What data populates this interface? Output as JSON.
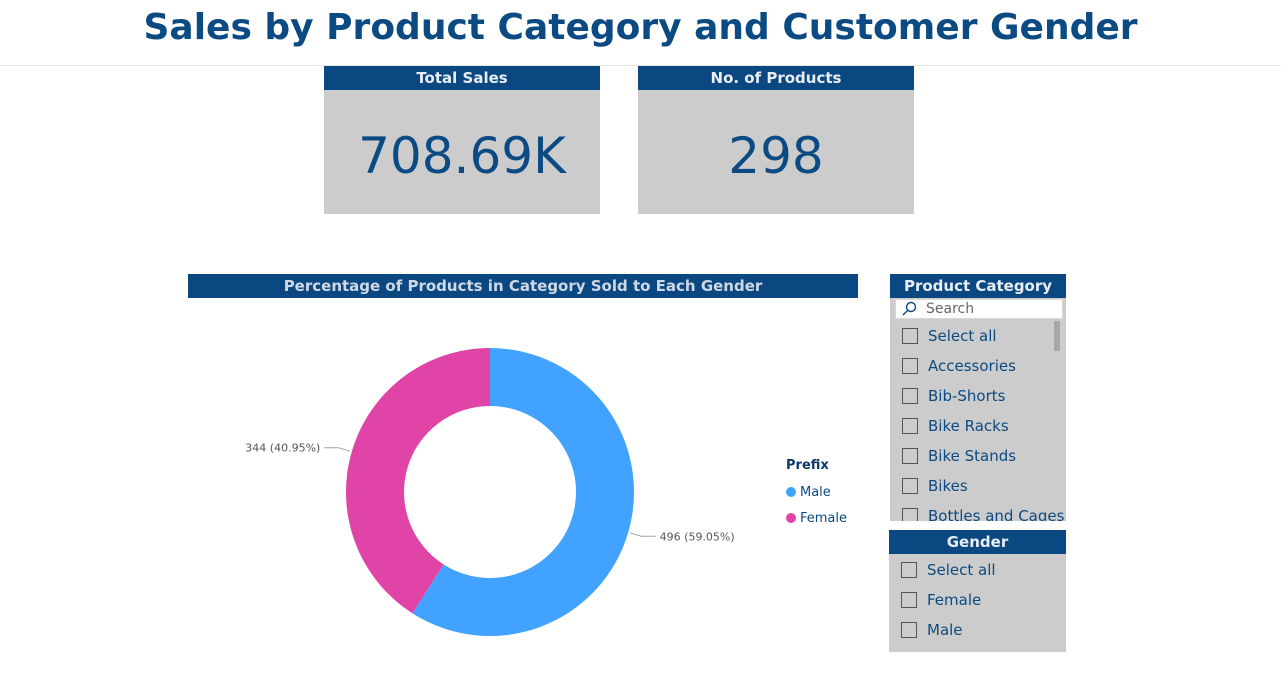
{
  "title": "Sales by Product Category and Customer Gender",
  "cards": {
    "total_sales": {
      "label": "Total Sales",
      "value": "708.69K"
    },
    "num_products": {
      "label": "No. of Products",
      "value": "298"
    }
  },
  "donut": {
    "title": "Percentage of Products in Category Sold to Each Gender",
    "legend_title": "Prefix"
  },
  "chart_data": {
    "type": "pie",
    "donut": true,
    "title": "Percentage of Products in Category Sold to Each Gender",
    "legend_title": "Prefix",
    "legend_position": "right",
    "categories": [
      "Male",
      "Female"
    ],
    "values": [
      496,
      344
    ],
    "percentages": [
      59.05,
      40.95
    ],
    "data_labels": [
      "496 (59.05%)",
      "344 (40.95%)"
    ],
    "colors": [
      "#41a3ff",
      "#e044a7"
    ]
  },
  "slicers": {
    "category": {
      "title": "Product Category",
      "search_placeholder": "Search",
      "items": [
        "Select all",
        "Accessories",
        "Bib-Shorts",
        "Bike Racks",
        "Bike Stands",
        "Bikes",
        "Bottles and Cages"
      ]
    },
    "gender": {
      "title": "Gender",
      "items": [
        "Select all",
        "Female",
        "Male"
      ]
    }
  },
  "colors": {
    "header_bg": "#0b4780",
    "text_primary": "#0b4a82",
    "card_bg": "#cccccc",
    "male": "#41a3ff",
    "female": "#e044a7"
  },
  "icons": {
    "search": "search-icon"
  }
}
